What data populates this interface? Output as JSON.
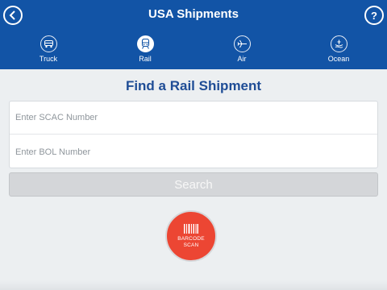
{
  "header": {
    "title": "USA Shipments",
    "back_icon": "chevron-left-icon",
    "help_icon": "help-icon",
    "help_glyph": "?"
  },
  "tabs": [
    {
      "label": "Truck",
      "icon": "truck-icon",
      "active": false
    },
    {
      "label": "Rail",
      "icon": "rail-icon",
      "active": true
    },
    {
      "label": "Air",
      "icon": "airplane-icon",
      "active": false
    },
    {
      "label": "Ocean",
      "icon": "ship-icon",
      "active": false
    }
  ],
  "main": {
    "heading": "Find a Rail Shipment",
    "scac_placeholder": "Enter SCAC Number",
    "bol_placeholder": "Enter BOL Number",
    "search_label": "Search",
    "scan_label_line1": "BARCODE",
    "scan_label_line2": "SCAN"
  },
  "colors": {
    "header_bg": "#1254a6",
    "heading": "#1f4d96",
    "scan_button": "#ec4633"
  }
}
